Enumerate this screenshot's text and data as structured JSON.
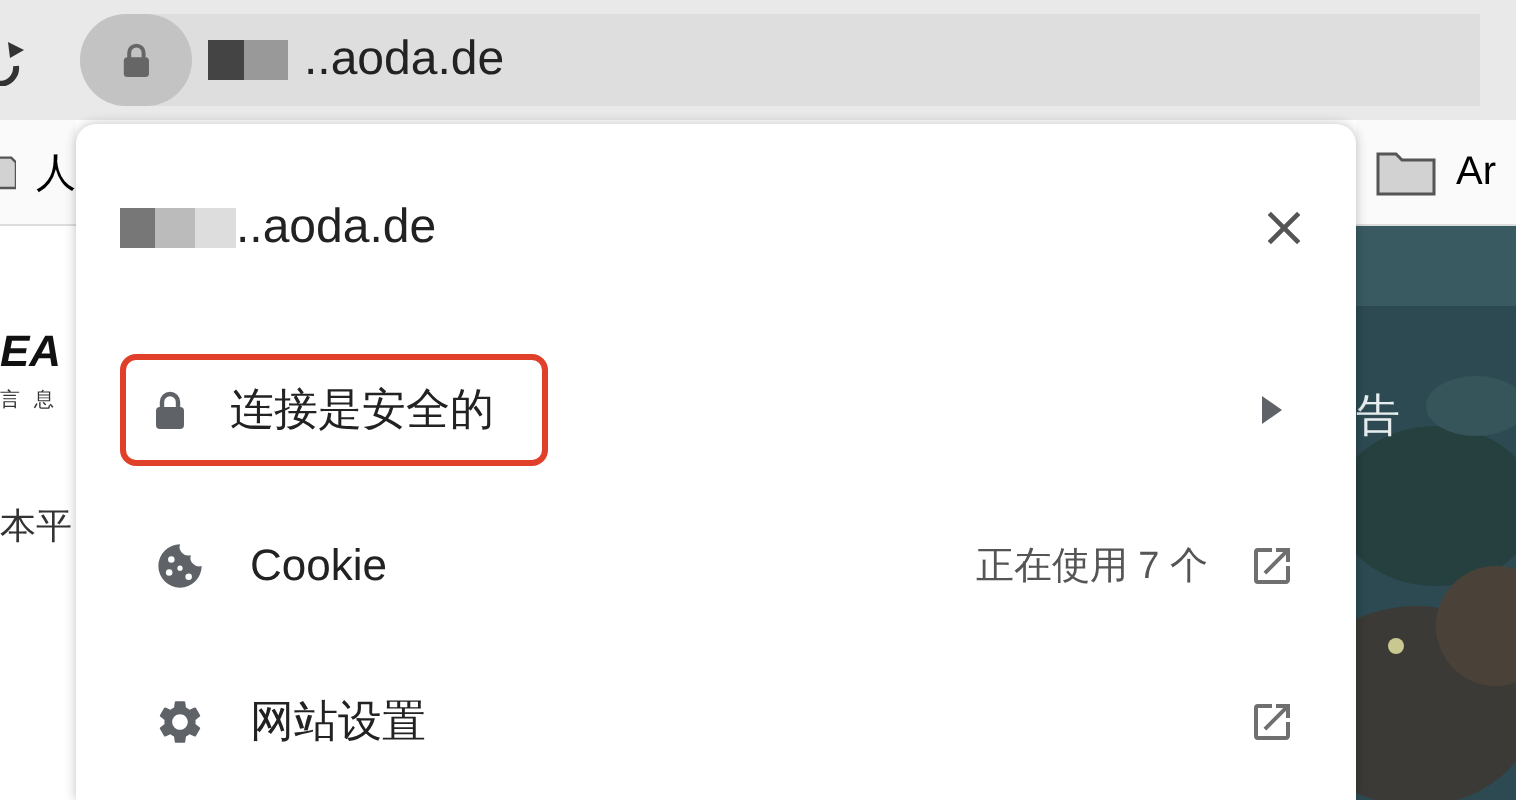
{
  "toolbar": {
    "address": "..aoda.de"
  },
  "bookmarks_bar": {
    "left_item": "人",
    "right_item": "Ar"
  },
  "page": {
    "logo": "EA",
    "logo_subtitle": "言 息",
    "text_left": "本平",
    "text_right": "告"
  },
  "popup": {
    "site": "..aoda.de",
    "items": [
      {
        "kind": "submenu",
        "label": "连接是安全的",
        "highlighted": true
      },
      {
        "kind": "link",
        "label": "Cookie",
        "detail": "正在使用 7 个",
        "highlighted": false
      },
      {
        "kind": "link",
        "label": "网站设置",
        "highlighted": false
      }
    ]
  }
}
